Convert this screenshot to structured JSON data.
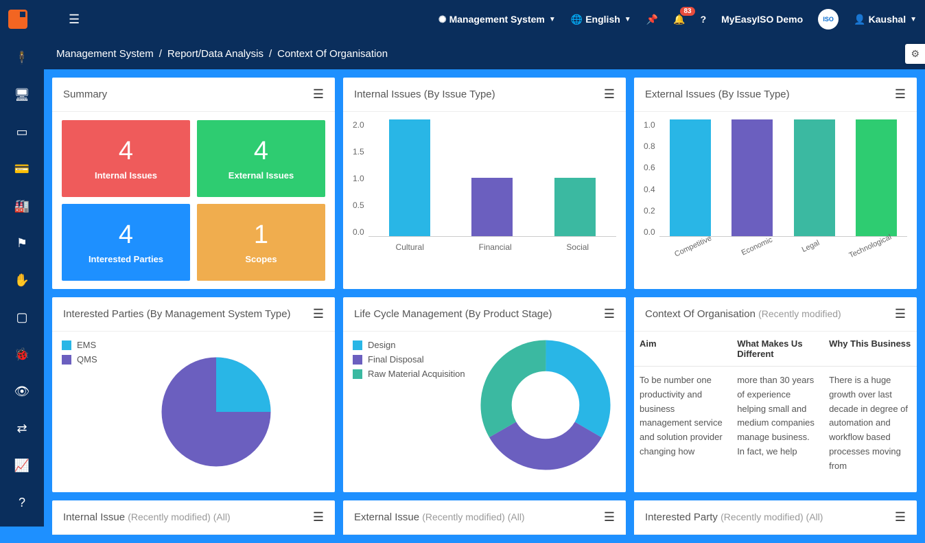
{
  "topbar": {
    "system_label": "Management System",
    "language_label": "English",
    "notification_count": "83",
    "org_name": "MyEasyISO Demo",
    "user_name": "Kaushal"
  },
  "breadcrumb": {
    "a": "Management System",
    "b": "Report/Data Analysis",
    "c": "Context Of Organisation"
  },
  "panels": {
    "summary": {
      "title": "Summary",
      "tiles": [
        {
          "value": "4",
          "label": "Internal Issues",
          "color": "red"
        },
        {
          "value": "4",
          "label": "External Issues",
          "color": "green"
        },
        {
          "value": "4",
          "label": "Interested Parties",
          "color": "blue"
        },
        {
          "value": "1",
          "label": "Scopes",
          "color": "orange"
        }
      ]
    },
    "internal_issues": {
      "title": "Internal Issues (By Issue Type)"
    },
    "external_issues": {
      "title": "External Issues (By Issue Type)"
    },
    "interested_parties": {
      "title": "Interested Parties (By Management System Type)",
      "legend": [
        {
          "label": "EMS",
          "color": "#29b6e6"
        },
        {
          "label": "QMS",
          "color": "#6b5fbf"
        }
      ]
    },
    "lifecycle": {
      "title": "Life Cycle Management (By Product Stage)",
      "legend": [
        {
          "label": "Design",
          "color": "#29b6e6"
        },
        {
          "label": "Final Disposal",
          "color": "#6b5fbf"
        },
        {
          "label": "Raw Material Acquisition",
          "color": "#3bb9a1"
        }
      ]
    },
    "context": {
      "title": "Context Of Organisation",
      "subtitle": "(Recently modified)",
      "headers": {
        "aim": "Aim",
        "diff": "What Makes Us Different",
        "why": "Why This Business"
      },
      "row": {
        "aim": "To be number one productivity and business management service and solution provider changing how",
        "diff": "more than 30 years of experience helping small and medium companies manage business. In fact, we help",
        "why": "There is a huge growth over last decade in degree of automation and workflow based processes moving from"
      }
    },
    "internal_issue_list": {
      "title": "Internal Issue",
      "sub": "(Recently modified) (All)"
    },
    "external_issue_list": {
      "title": "External Issue",
      "sub": "(Recently modified) (All)"
    },
    "interested_party_list": {
      "title": "Interested Party",
      "sub": "(Recently modified) (All)"
    }
  },
  "chart_data": [
    {
      "id": "internal_issues_bar",
      "type": "bar",
      "title": "Internal Issues (By Issue Type)",
      "categories": [
        "Cultural",
        "Financial",
        "Social"
      ],
      "values": [
        2.0,
        1.0,
        1.0
      ],
      "colors": [
        "#29b6e6",
        "#6b5fbf",
        "#3bb9a1"
      ],
      "ylim": [
        0,
        2.0
      ],
      "yticks": [
        0,
        0.5,
        1.0,
        1.5,
        2.0
      ]
    },
    {
      "id": "external_issues_bar",
      "type": "bar",
      "title": "External Issues (By Issue Type)",
      "categories": [
        "Competitive",
        "Economic",
        "Legal",
        "Technological"
      ],
      "values": [
        1.0,
        1.0,
        1.0,
        1.0
      ],
      "colors": [
        "#29b6e6",
        "#6b5fbf",
        "#3bb9a1",
        "#2ecc71"
      ],
      "ylim": [
        0,
        1.0
      ],
      "yticks": [
        0,
        0.2,
        0.4,
        0.6,
        0.8,
        1.0
      ]
    },
    {
      "id": "interested_parties_pie",
      "type": "pie",
      "title": "Interested Parties (By Management System Type)",
      "series": [
        {
          "name": "EMS",
          "value": 1,
          "color": "#29b6e6"
        },
        {
          "name": "QMS",
          "value": 3,
          "color": "#6b5fbf"
        }
      ]
    },
    {
      "id": "lifecycle_donut",
      "type": "pie",
      "title": "Life Cycle Management (By Product Stage)",
      "series": [
        {
          "name": "Design",
          "value": 1,
          "color": "#29b6e6"
        },
        {
          "name": "Final Disposal",
          "value": 1,
          "color": "#6b5fbf"
        },
        {
          "name": "Raw Material Acquisition",
          "value": 1,
          "color": "#3bb9a1"
        }
      ]
    }
  ]
}
